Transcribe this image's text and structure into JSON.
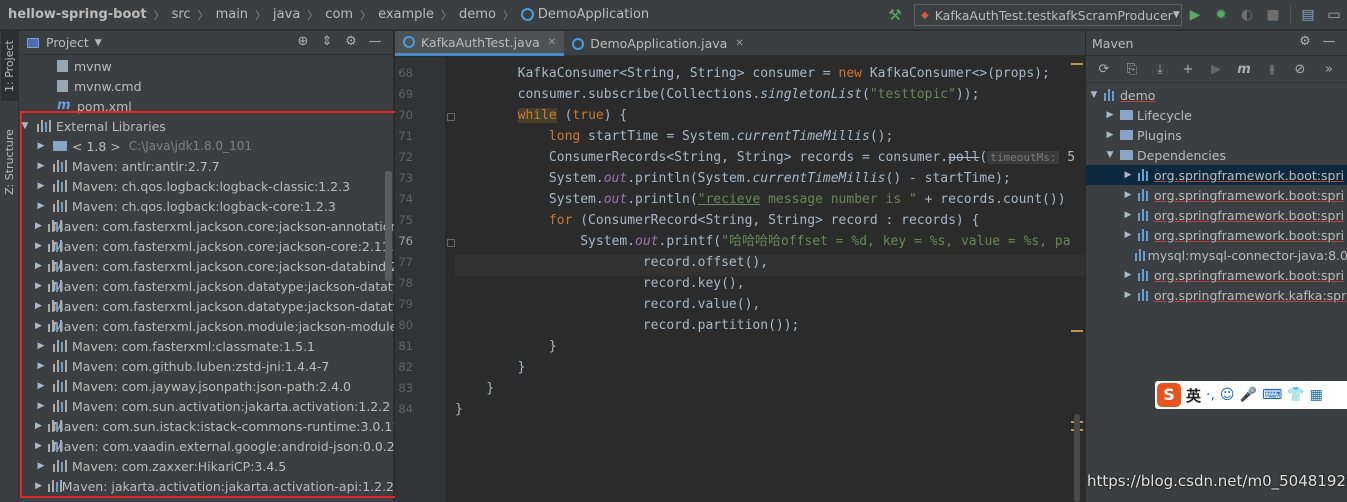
{
  "breadcrumb": {
    "items": [
      "hellow-spring-boot",
      "src",
      "main",
      "java",
      "com",
      "example",
      "demo",
      "DemoApplication"
    ]
  },
  "run_config": {
    "label": "KafkaAuthTest.testkafkScramProducer"
  },
  "left_strip": {
    "tab_project": "1: Project",
    "tab_structure": "Z: Structure"
  },
  "project_panel": {
    "title": "Project",
    "icons": [
      "target-icon",
      "collapse-icon",
      "gear-icon",
      "minimize-icon"
    ],
    "files": [
      {
        "label": "mvnw",
        "icon": "file-icon"
      },
      {
        "label": "mvnw.cmd",
        "icon": "file-icon"
      },
      {
        "label": "pom.xml",
        "icon": "maven-file-icon"
      }
    ],
    "external_libraries": "External Libraries",
    "jdk": {
      "label": "< 1.8 >",
      "path": "C:\\Java\\jdk1.8.0_101"
    },
    "libraries": [
      "Maven: antlr:antlr:2.7.7",
      "Maven: ch.qos.logback:logback-classic:1.2.3",
      "Maven: ch.qos.logback:logback-core:1.2.3",
      "Maven: com.fasterxml.jackson.core:jackson-annotations",
      "Maven: com.fasterxml.jackson.core:jackson-core:2.11.3",
      "Maven: com.fasterxml.jackson.core:jackson-databind:2.",
      "Maven: com.fasterxml.jackson.datatype:jackson-datatyp",
      "Maven: com.fasterxml.jackson.datatype:jackson-datatyp",
      "Maven: com.fasterxml.jackson.module:jackson-module-",
      "Maven: com.fasterxml:classmate:1.5.1",
      "Maven: com.github.luben:zstd-jni:1.4.4-7",
      "Maven: com.jayway.jsonpath:json-path:2.4.0",
      "Maven: com.sun.activation:jakarta.activation:1.2.2",
      "Maven: com.sun.istack:istack-commons-runtime:3.0.11",
      "Maven: com.vaadin.external.google:android-json:0.0.20",
      "Maven: com.zaxxer:HikariCP:3.4.5",
      "Maven: jakarta.activation:jakarta.activation-api:1.2.2"
    ]
  },
  "editor": {
    "tabs": [
      {
        "label": "KafkaAuthTest.java",
        "active": true
      },
      {
        "label": "DemoApplication.java",
        "active": false
      }
    ],
    "line_numbers": [
      "68",
      "69",
      "70",
      "71",
      "72",
      "73",
      "74",
      "75",
      "76",
      "77",
      "78",
      "79",
      "80",
      "81",
      "82",
      "83",
      "84"
    ],
    "current_line": "76",
    "code": {
      "l68a": "        KafkaConsumer<String, String> consumer = ",
      "l68kw": "new",
      "l68b": " KafkaConsumer<>(props);",
      "l69a": "        consumer.subscribe(Collections.",
      "l69m": "singletonList",
      "l69b": "(",
      "l69s": "\"testtopic\"",
      "l69c": "));",
      "l70kw": "while",
      "l70a": " (",
      "l70kw2": "true",
      "l70b": ") {",
      "l71kw": "long",
      "l71a": " startTime = System.",
      "l71m": "currentTimeMillis",
      "l71b": "();",
      "l72a": "            ConsumerRecords<String, String> records = consumer.",
      "l72m": "poll",
      "l72b": "(",
      "l72hint": "timeoutMs:",
      "l72c": " 5",
      "l73a": "            System.",
      "l73f": "out",
      "l73b": ".println(System.",
      "l73m": "currentTimeMillis",
      "l73c": "() - startTime);",
      "l74a": "            System.",
      "l74f": "out",
      "l74b": ".println(",
      "l74s1": "\"recieve",
      "l74s2": " message number is \"",
      "l74c": " + records.count())",
      "l75kw": "for",
      "l75a": " (ConsumerRecord<String, String> record : records) {",
      "l76a": "                System.",
      "l76f": "out",
      "l76b": ".printf(",
      "l76s": "\"哈哈哈哈offset = %d, key = %s, value = %s, pa",
      "l77a": "                        record.offset(),",
      "l78a": "                        record.key(),",
      "l79a": "                        record.value(),",
      "l80a": "                        record.partition());",
      "l81a": "            }",
      "l82a": "        }",
      "l83a": "    }",
      "l84a": "}"
    }
  },
  "maven": {
    "title": "Maven",
    "tree": [
      {
        "label": "demo",
        "level": 0,
        "arrow": "down",
        "icon": "maven-project-icon"
      },
      {
        "label": "Lifecycle",
        "level": 1,
        "arrow": "right",
        "icon": "folder-icon"
      },
      {
        "label": "Plugins",
        "level": 1,
        "arrow": "right",
        "icon": "folder-icon"
      },
      {
        "label": "Dependencies",
        "level": 1,
        "arrow": "down",
        "icon": "folder-icon"
      },
      {
        "label": "org.springframework.boot:spri",
        "level": 2,
        "arrow": "right",
        "icon": "dependency-icon",
        "selected": true
      },
      {
        "label": "org.springframework.boot:spri",
        "level": 2,
        "arrow": "right",
        "icon": "dependency-icon"
      },
      {
        "label": "org.springframework.boot:spri",
        "level": 2,
        "arrow": "right",
        "icon": "dependency-icon"
      },
      {
        "label": "org.springframework.boot:spri",
        "level": 2,
        "arrow": "right",
        "icon": "dependency-icon"
      },
      {
        "label": "mysql:mysql-connector-java:8.0",
        "level": 2,
        "arrow": "none",
        "icon": "dependency-icon"
      },
      {
        "label": "org.springframework.boot:spri",
        "level": 2,
        "arrow": "right",
        "icon": "dependency-icon"
      },
      {
        "label": "org.springframework.kafka:spr",
        "level": 2,
        "arrow": "right",
        "icon": "dependency-icon"
      }
    ]
  },
  "ime": {
    "lang": "英",
    "items": [
      "·,",
      "☺",
      "🎤",
      "⌨",
      "👕",
      "▦"
    ]
  },
  "watermark": "https://blog.csdn.net/m0_50481928",
  "colors": {
    "highlight_box": "#e0282a",
    "keyword": "#cc7832",
    "string": "#6a8759",
    "field": "#9876aa"
  }
}
